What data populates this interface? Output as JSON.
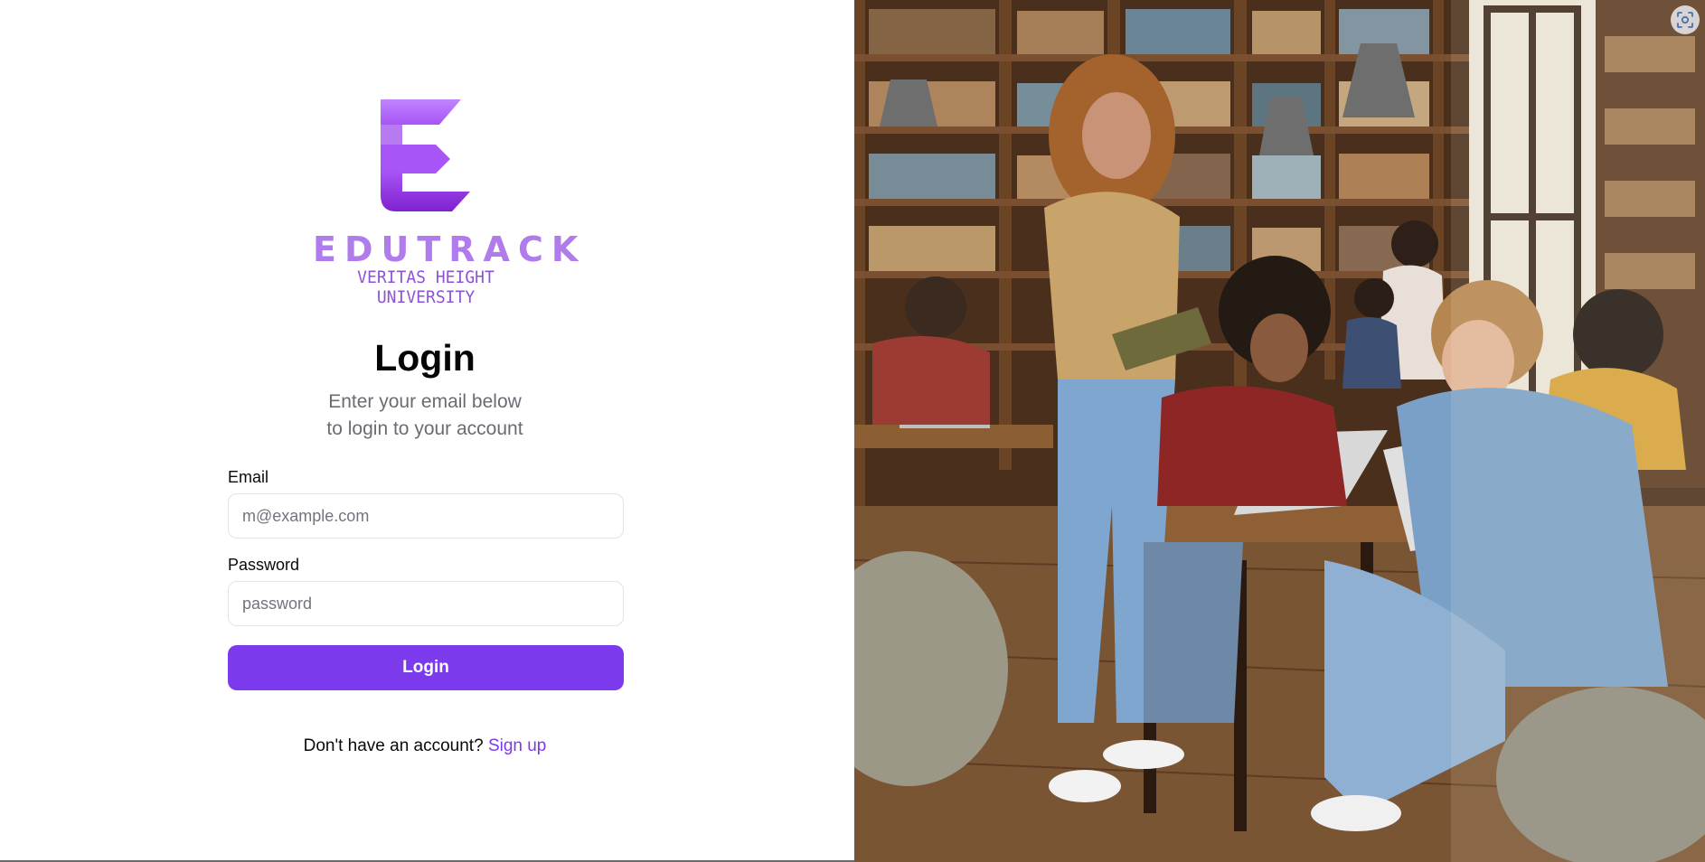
{
  "brand": {
    "name": "EDUTRACK",
    "subtitle": "VERITAS HEIGHT UNIVERSITY",
    "colors": {
      "light": "#c084fc",
      "mid": "#a855f7",
      "dark": "#7e22ce"
    }
  },
  "form": {
    "title": "Login",
    "subtitle_line1": "Enter your email below",
    "subtitle_line2": "to login to your account",
    "email_label": "Email",
    "email_placeholder": "m@example.com",
    "email_value": "",
    "password_label": "Password",
    "password_placeholder": "password",
    "password_value": "",
    "submit_label": "Login",
    "signup_prompt": "Don't have an account?",
    "signup_link": "Sign up"
  },
  "hero": {
    "scan_icon": "scan-icon"
  },
  "colors": {
    "accent": "#7c3aed",
    "text": "#0a0a0a",
    "muted": "#6b6b73"
  }
}
